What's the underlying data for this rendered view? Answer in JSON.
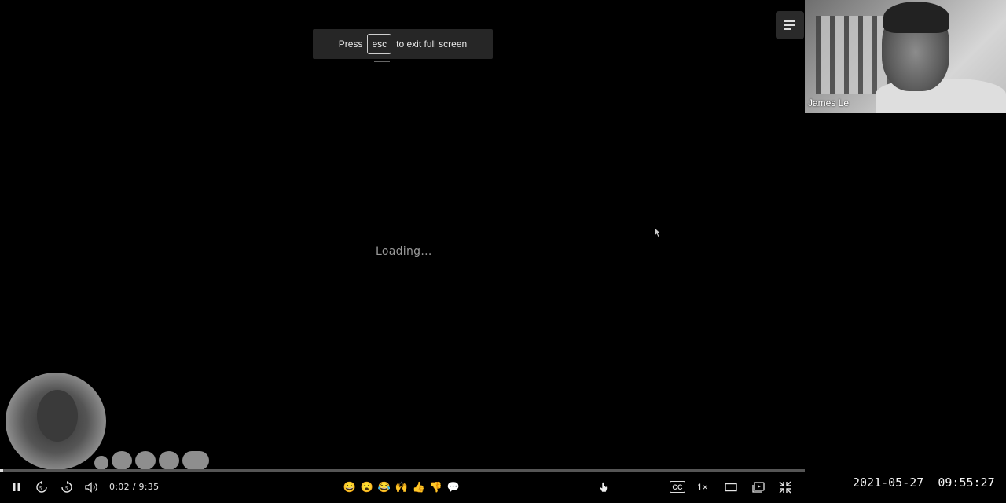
{
  "banner": {
    "press": "Press",
    "key": "esc",
    "suffix": "to exit full screen"
  },
  "player": {
    "loading_text": "Loading...",
    "time_display": "0:02 / 9:35",
    "progress_fraction": 0.0035,
    "speed_label": "1×",
    "cc_label": "CC"
  },
  "webcam": {
    "name": "James Le"
  },
  "reactions": [
    "😀",
    "😮",
    "😂",
    "🙌",
    "👍",
    "👎",
    "💬"
  ],
  "icons": {
    "pause": "pause-icon",
    "rewind": "rewind-5-icon",
    "forward": "forward-5-icon",
    "volume": "volume-icon",
    "menu": "menu-icon",
    "theater": "theater-mode-icon",
    "miniplayer": "picture-in-picture-icon",
    "fullscreen_exit": "exit-fullscreen-icon"
  },
  "overlay": {
    "timestamp": "2021-05-27  09:55:27"
  }
}
